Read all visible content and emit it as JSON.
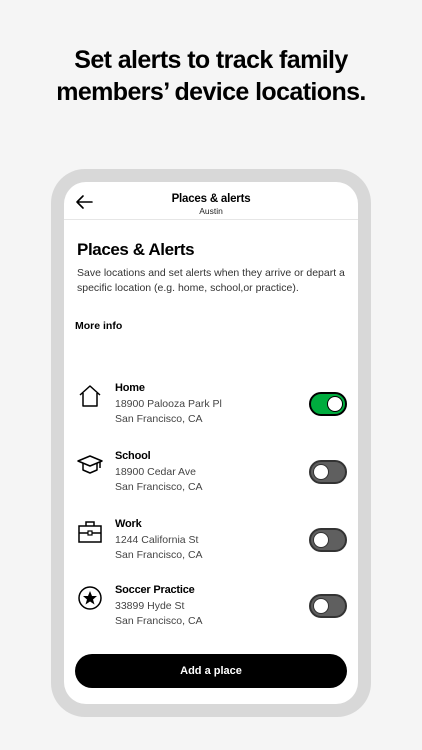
{
  "headline": {
    "line1": "Set alerts to track family",
    "line2": "members’ device locations."
  },
  "nav": {
    "title": "Places & alerts",
    "subtitle": "Austin",
    "back_icon": "arrow-left-icon"
  },
  "page": {
    "title": "Places & Alerts",
    "description": "Save locations and set alerts when they arrive or depart a specific location (e.g. home, school,or practice).",
    "more_info": "More info"
  },
  "places": [
    {
      "name": "Home",
      "line1": "18900 Palooza Park Pl",
      "line2": "San Francisco, CA",
      "icon": "house-icon",
      "alert_on": true
    },
    {
      "name": "School",
      "line1": "18900 Cedar Ave",
      "line2": "San Francisco, CA",
      "icon": "graduation-cap-icon",
      "alert_on": false
    },
    {
      "name": "Work",
      "line1": "1244 California St",
      "line2": "San Francisco, CA",
      "icon": "briefcase-icon",
      "alert_on": false
    },
    {
      "name": "Soccer Practice",
      "line1": "33899 Hyde St",
      "line2": "San Francisco, CA",
      "icon": "star-badge-icon",
      "alert_on": false
    }
  ],
  "add_button": "Add a place",
  "colors": {
    "toggle_on": "#00ac3e",
    "toggle_off": "#5f5f5f",
    "button": "#000000",
    "background": "#f5f5f5"
  }
}
